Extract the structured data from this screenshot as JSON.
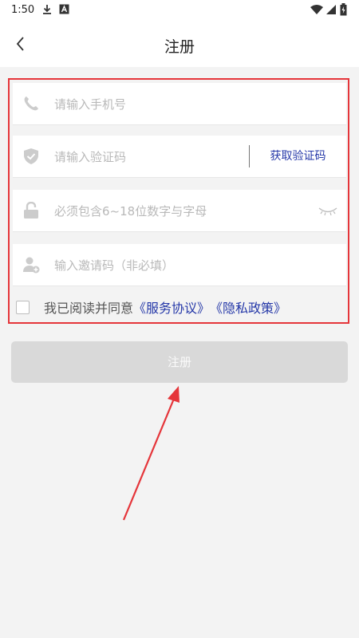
{
  "status_bar": {
    "time": "1:50"
  },
  "header": {
    "title": "注册"
  },
  "form": {
    "phone": {
      "placeholder": "请输入手机号"
    },
    "code": {
      "placeholder": "请输入验证码",
      "get_code_label": "获取验证码"
    },
    "password": {
      "placeholder": "必须包含6~18位数字与字母"
    },
    "invite": {
      "placeholder": "输入邀请码（非必填）"
    }
  },
  "agreement": {
    "text": "我已阅读并同意",
    "service_link": "《服务协议》",
    "privacy_link": "《隐私政策》"
  },
  "register_button": {
    "label": "注册"
  },
  "colors": {
    "accent": "#2538a8",
    "highlight_border": "#e5353a",
    "button_disabled": "#d9d9d9",
    "background": "#f3f3f3"
  },
  "icons": [
    "download-icon",
    "a-badge-icon",
    "wifi-icon",
    "signal-icon",
    "battery-icon",
    "back-icon",
    "phone-icon",
    "shield-icon",
    "lock-icon",
    "add-user-icon",
    "eye-closed-icon"
  ]
}
